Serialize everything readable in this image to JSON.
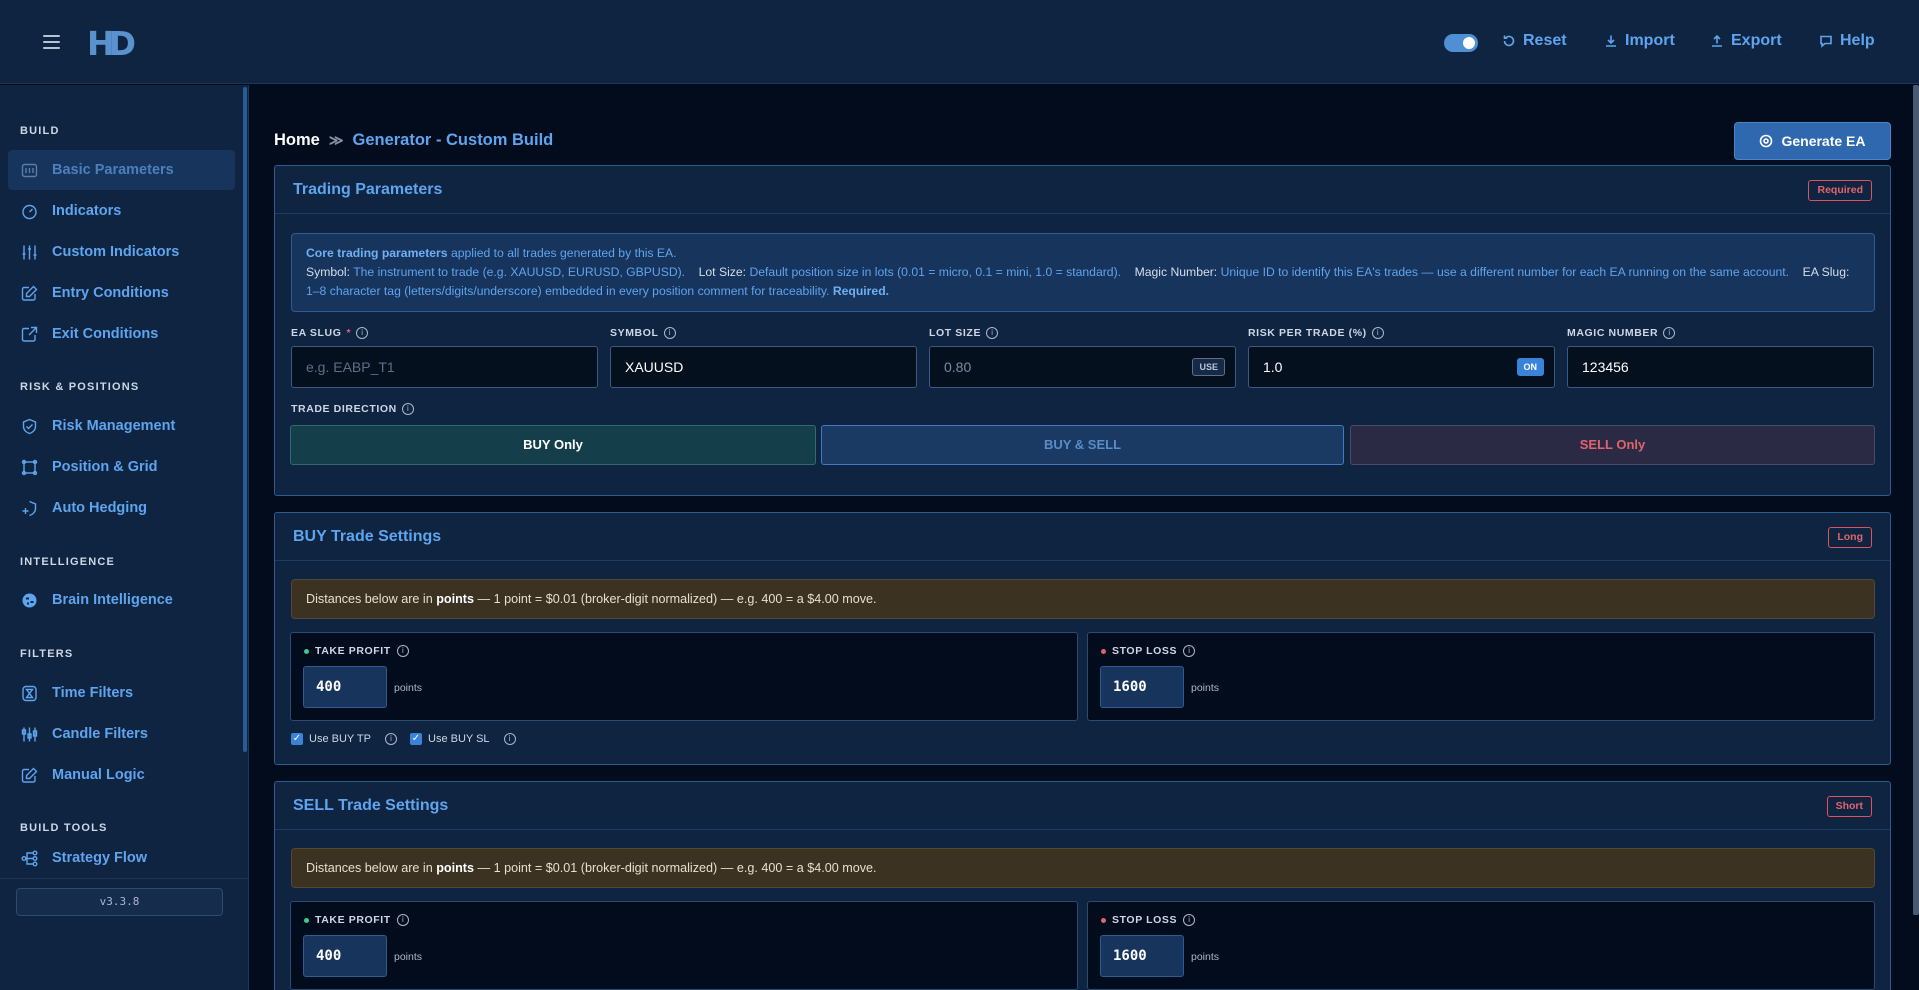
{
  "app": {
    "logo": "HD"
  },
  "topbar": {
    "toggle_on": true,
    "reset_label": "Reset",
    "import_label": "Import",
    "export_label": "Export",
    "help_label": "Help"
  },
  "sidebar": {
    "sections": [
      {
        "title": "BUILD",
        "items": [
          {
            "label": "Basic Parameters",
            "icon": "sliders-icon",
            "active": true
          },
          {
            "label": "Indicators",
            "icon": "gauge-icon"
          },
          {
            "label": "Custom Indicators",
            "icon": "adjustments-icon"
          },
          {
            "label": "Entry Conditions",
            "icon": "edit-icon"
          },
          {
            "label": "Exit Conditions",
            "icon": "external-link-icon"
          }
        ]
      },
      {
        "title": "RISK & POSITIONS",
        "items": [
          {
            "label": "Risk Management",
            "icon": "shield-check-icon"
          },
          {
            "label": "Position & Grid",
            "icon": "grid-frame-icon"
          },
          {
            "label": "Auto Hedging",
            "icon": "hedge-icon"
          }
        ]
      },
      {
        "title": "INTELLIGENCE",
        "items": [
          {
            "label": "Brain Intelligence",
            "icon": "brain-icon"
          }
        ]
      },
      {
        "title": "FILTERS",
        "items": [
          {
            "label": "Time Filters",
            "icon": "hourglass-icon"
          },
          {
            "label": "Candle Filters",
            "icon": "candles-icon"
          },
          {
            "label": "Manual Logic",
            "icon": "pencil-icon"
          }
        ]
      },
      {
        "title": "BUILD TOOLS",
        "items": [
          {
            "label": "Strategy Flow",
            "icon": "flow-icon"
          }
        ]
      }
    ],
    "version": "v3.3.8"
  },
  "breadcrumb": {
    "home": "Home",
    "separator": "≫",
    "current": "Generator - Custom Build"
  },
  "generate_button": "Generate EA",
  "trading_parameters": {
    "title": "Trading Parameters",
    "badge": "Required",
    "info": {
      "lead_bold": "Core trading parameters",
      "lead_rest": " applied to all trades generated by this EA.",
      "symbol_key": "Symbol:",
      "symbol_desc": " The instrument to trade (e.g. XAUUSD, EURUSD, GBPUSD).",
      "lot_key": "Lot Size:",
      "lot_desc": " Default position size in lots (0.01 = micro, 0.1 = mini, 1.0 = standard).",
      "magic_key": "Magic Number:",
      "magic_desc": " Unique ID to identify this EA's trades — use a different number for each EA running on the same account.",
      "slug_key": "EA Slug:",
      "slug_desc": " 1–8 character tag (letters/digits/underscore) embedded in every position comment for traceability.",
      "required": "Required."
    },
    "fields": {
      "ea_slug": {
        "label": "EA SLUG",
        "required_mark": "*",
        "placeholder": "e.g. EABP_T1"
      },
      "symbol": {
        "label": "SYMBOL",
        "value": "XAUUSD"
      },
      "lot_size": {
        "label": "LOT SIZE",
        "value": "0.80",
        "tag": "USE"
      },
      "risk_per_trade": {
        "label": "RISK PER TRADE (%)",
        "value": "1.0",
        "tag": "ON"
      },
      "magic_number": {
        "label": "MAGIC NUMBER",
        "value": "123456"
      }
    },
    "trade_direction": {
      "label": "TRADE DIRECTION",
      "options": [
        "BUY Only",
        "BUY & SELL",
        "SELL Only"
      ],
      "selected": "BUY Only"
    }
  },
  "buy_settings": {
    "title": "BUY Trade Settings",
    "badge": "Long",
    "note_pre": "Distances below are in ",
    "note_bold": "points",
    "note_post": " — 1 point = $0.01 (broker-digit normalized) — e.g. 400 = a $4.00 move.",
    "take_profit": {
      "label": "TAKE PROFIT",
      "value": "400",
      "unit": "points"
    },
    "stop_loss": {
      "label": "STOP LOSS",
      "value": "1600",
      "unit": "points"
    },
    "use_tp": {
      "label": "Use BUY TP",
      "checked": true
    },
    "use_sl": {
      "label": "Use BUY SL",
      "checked": true
    }
  },
  "sell_settings": {
    "title": "SELL Trade Settings",
    "badge": "Short",
    "note_pre": "Distances below are in ",
    "note_bold": "points",
    "note_post": " — 1 point = $0.01 (broker-digit normalized) — e.g. 400 = a $4.00 move.",
    "take_profit": {
      "label": "TAKE PROFIT",
      "value": "400",
      "unit": "points"
    },
    "stop_loss": {
      "label": "STOP LOSS",
      "value": "1600",
      "unit": "points"
    }
  },
  "colors": {
    "accent": "#5fa4ee",
    "danger": "#e0646e",
    "success": "#40c98e",
    "background": "#030c1c",
    "panel": "#0f2440"
  }
}
